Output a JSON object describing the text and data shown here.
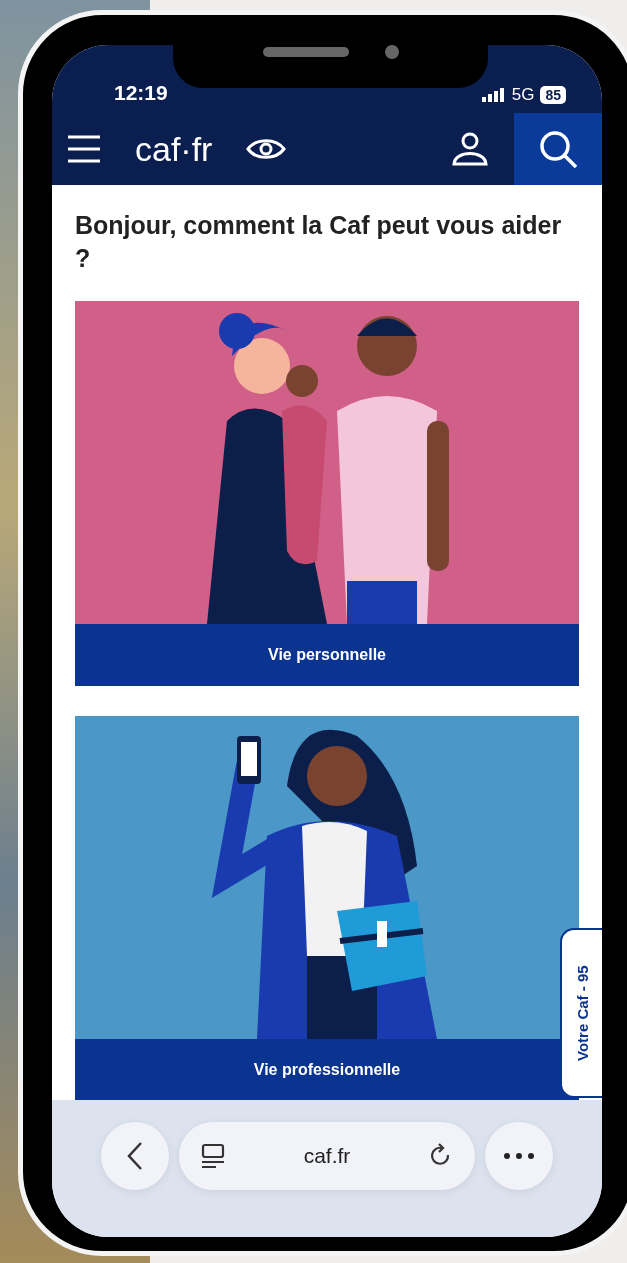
{
  "status_bar": {
    "time": "12:19",
    "network": "5G",
    "battery": "85"
  },
  "header": {
    "logo": "caf·fr"
  },
  "heading": "Bonjour, comment la Caf peut vous aider ?",
  "cards": [
    {
      "label": "Vie personnelle",
      "kind": "family"
    },
    {
      "label": "Vie professionnelle",
      "kind": "worker"
    }
  ],
  "side_tab": "Votre Caf - 95",
  "browser_bar": {
    "url": "caf.fr"
  }
}
